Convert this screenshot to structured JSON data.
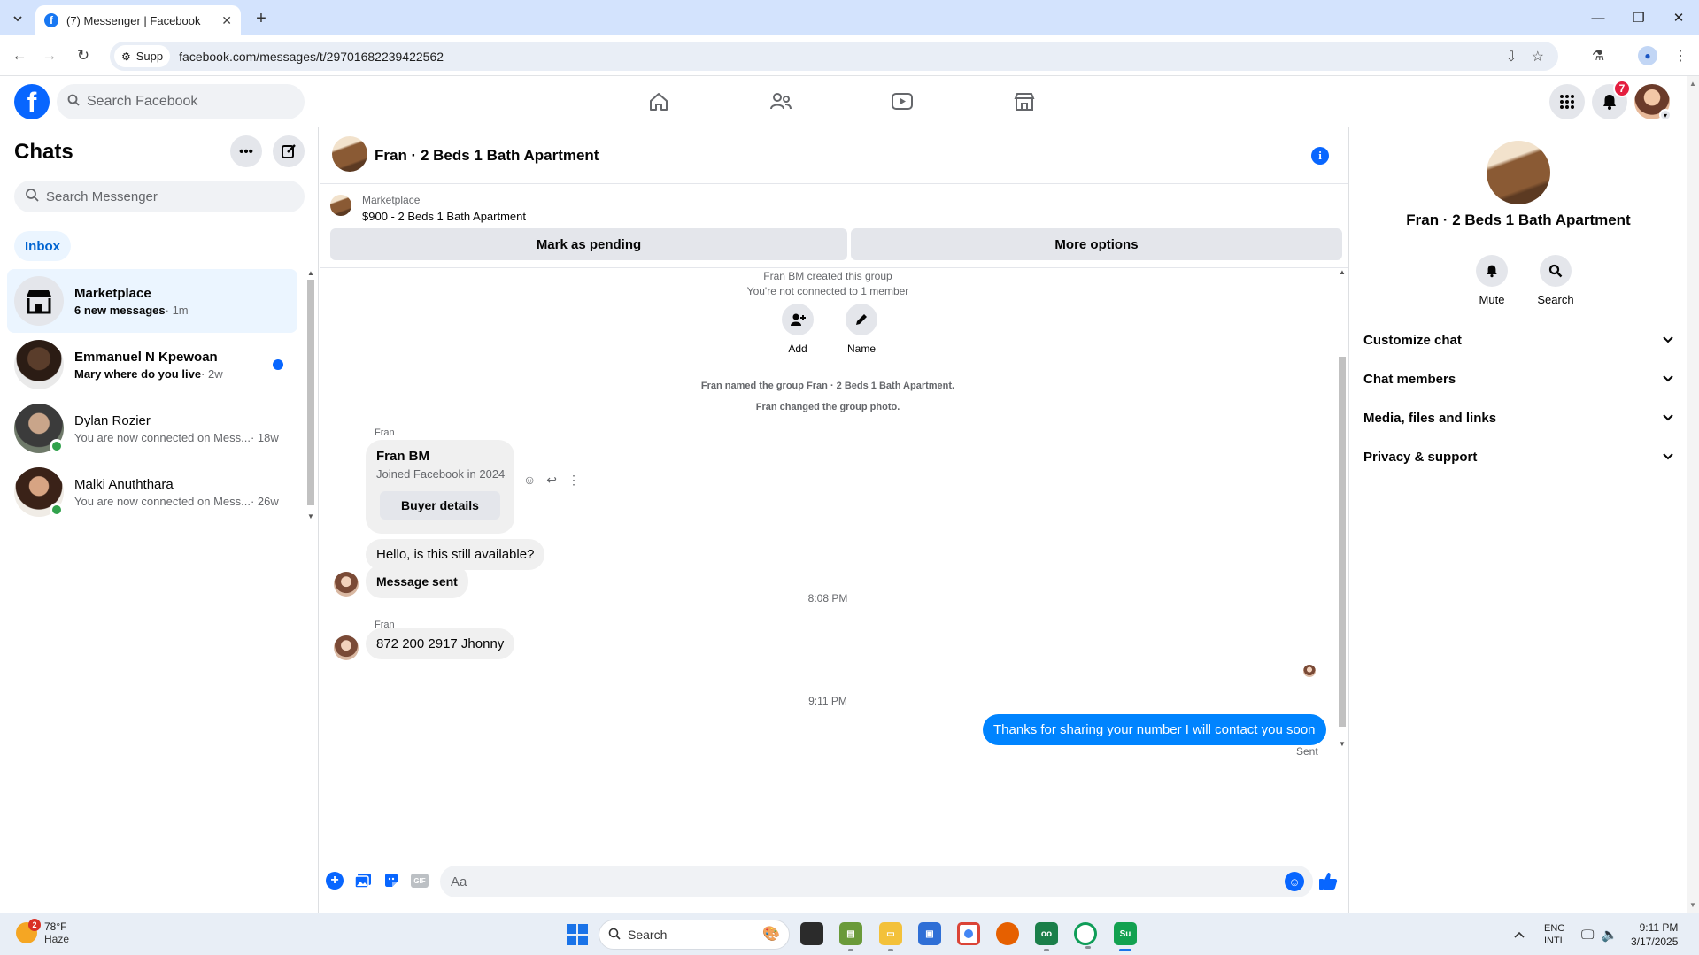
{
  "browser": {
    "tab_title": "(7) Messenger | Facebook",
    "new_tab": "+",
    "site_chip": "Supp",
    "url": "facebook.com/messages/t/29701682239422562"
  },
  "fb_header": {
    "search_placeholder": "Search Facebook",
    "notification_count": "7"
  },
  "chats": {
    "title": "Chats",
    "search_placeholder": "Search Messenger",
    "inbox_label": "Inbox",
    "items": [
      {
        "name": "Marketplace",
        "preview": "6 new messages",
        "time": "· 1m",
        "unread": true,
        "active": true
      },
      {
        "name": "Emmanuel N Kpewoan",
        "preview": "Mary where do you live",
        "time": "· 2w",
        "unread": true,
        "active": false
      },
      {
        "name": "Dylan Rozier",
        "preview": "You are now connected on Mess...",
        "time": "· 18w",
        "unread": false,
        "active": false
      },
      {
        "name": "Malki Anuththara",
        "preview": "You are now connected on Mess...",
        "time": "· 26w",
        "unread": false,
        "active": false
      }
    ]
  },
  "conversation": {
    "title": "Fran · 2 Beds 1 Bath Apartment",
    "marketplace_label": "Marketplace",
    "listing": "$900 - 2 Beds 1 Bath Apartment",
    "mark_pending": "Mark as pending",
    "more_options": "More options",
    "created_group": "Fran BM created this group",
    "not_connected": "You're not connected to 1 member",
    "add_label": "Add",
    "name_label": "Name",
    "named_group": "Fran named the group Fran · 2 Beds 1 Bath Apartment.",
    "changed_photo": "Fran changed the group photo.",
    "sender_1": "Fran",
    "buyer_name": "Fran BM",
    "buyer_joined": "Joined Facebook in 2024",
    "buyer_details": "Buyer details",
    "msg_available": "Hello, is this still available?",
    "msg_sent_label": "Message sent",
    "time_1": "8:08 PM",
    "sender_2": "Fran",
    "msg_number": "872 200 2917 Jhonny",
    "time_2": "9:11 PM",
    "out_message": "Thanks for sharing your number I will contact you soon",
    "sent_status": "Sent",
    "composer_placeholder": "Aa"
  },
  "info_pane": {
    "name": "Fran · 2 Beds 1 Bath Apartment",
    "mute": "Mute",
    "search": "Search",
    "sections": [
      "Customize chat",
      "Chat members",
      "Media, files and links",
      "Privacy & support"
    ]
  },
  "taskbar": {
    "weather_temp": "78°F",
    "weather_desc": "Haze",
    "weather_badge": "2",
    "search_label": "Search",
    "lang_1": "ENG",
    "lang_2": "INTL",
    "time": "9:11 PM",
    "date": "3/17/2025"
  },
  "colors": {
    "fb_blue": "#0866ff",
    "outgoing_bubble": "#0084ff",
    "active_chat_bg": "#ebf5ff",
    "notification_red": "#e41e3f",
    "online_green": "#31a24c"
  }
}
